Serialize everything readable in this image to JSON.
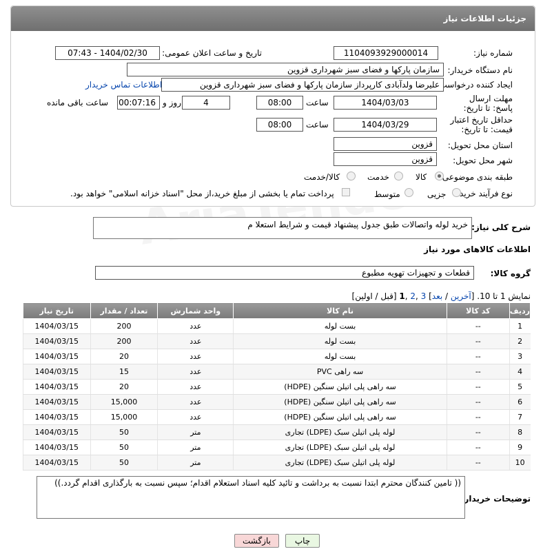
{
  "header": {
    "title": "جزئیات اطلاعات نیاز"
  },
  "watermark": "AriaTender.net",
  "form": {
    "need_number_label": "شماره نیاز:",
    "need_number": "1104093929000014",
    "announce_label": "تاریخ و ساعت اعلان عمومی:",
    "announce_value": "1404/02/30 - 07:43",
    "buyer_org_label": "نام دستگاه خریدار:",
    "buyer_org": "سازمان پارکها و فضای سبز شهرداری قزوین",
    "creator_label": "ایجاد کننده درخواست:",
    "creator": "علیرضا ولدآبادی کارپرداز سازمان پارکها و فضای سبز شهرداری قزوین",
    "contact_link": "اطلاعات تماس خریدار",
    "deadline_label": "مهلت ارسال پاسخ: تا تاریخ:",
    "deadline_date": "1404/03/03",
    "time_label": "ساعت",
    "deadline_time": "08:00",
    "days_value": "4",
    "days_label": "روز و",
    "remaining_value": "00:07:16",
    "remaining_label": "ساعت باقی مانده",
    "validity_label": "حداقل تاریخ اعتبار قیمت: تا تاریخ:",
    "validity_date": "1404/03/29",
    "validity_time": "08:00",
    "province_label": "استان محل تحویل:",
    "province": "قزوین",
    "city_label": "شهر محل تحویل:",
    "city": "قزوین",
    "category_label": "طبقه بندی موضوعی:",
    "category_options": [
      "کالا",
      "خدمت",
      "کالا/خدمت"
    ],
    "process_label": "نوع فرآیند خرید :",
    "process_options": [
      "جزیی",
      "متوسط"
    ],
    "payment_note": "پرداخت تمام یا بخشی از مبلغ خرید،از محل \"اسناد خزانه اسلامی\" خواهد بود."
  },
  "summary": {
    "label": "شرح کلی نیاز:",
    "value": "خرید لوله واتصالات طبق جدول پیشنهاد قیمت و شرایط استعلا م"
  },
  "goods": {
    "section_title": "اطلاعات کالاهای مورد نیاز",
    "group_label": "گروه کالا:",
    "group_value": "قطعات و تجهیزات تهویه مطبوع",
    "pagination": {
      "prefix": "نمایش 1 تا 10. [",
      "last": "آخرین",
      "sep1": " / ",
      "next": "بعد",
      "sep2": "] ",
      "page3": "3",
      "comma1": " ,",
      "page2": "2",
      "comma2": " ,",
      "page1": "1",
      "suffix": " [قبل / اولین]"
    },
    "columns": [
      "ردیف",
      "کد کالا",
      "نام کالا",
      "واحد شمارش",
      "تعداد / مقدار",
      "تاریخ نیاز"
    ],
    "rows": [
      [
        "1",
        "--",
        "بست لوله",
        "عدد",
        "200",
        "1404/03/15"
      ],
      [
        "2",
        "--",
        "بست لوله",
        "عدد",
        "200",
        "1404/03/15"
      ],
      [
        "3",
        "--",
        "بست لوله",
        "عدد",
        "20",
        "1404/03/15"
      ],
      [
        "4",
        "--",
        "سه راهی PVC",
        "عدد",
        "15",
        "1404/03/15"
      ],
      [
        "5",
        "--",
        "سه راهی پلی اتیلن سنگین (HDPE)",
        "عدد",
        "20",
        "1404/03/15"
      ],
      [
        "6",
        "--",
        "سه راهی پلی اتیلن سنگین (HDPE)",
        "عدد",
        "15,000",
        "1404/03/15"
      ],
      [
        "7",
        "--",
        "سه راهی پلی اتیلن سنگین (HDPE)",
        "عدد",
        "15,000",
        "1404/03/15"
      ],
      [
        "8",
        "--",
        "لوله پلی اتیلن سبک (LDPE) تجاری",
        "متر",
        "50",
        "1404/03/15"
      ],
      [
        "9",
        "--",
        "لوله پلی اتیلن سبک (LDPE) تجاری",
        "متر",
        "50",
        "1404/03/15"
      ],
      [
        "10",
        "--",
        "لوله پلی اتیلن سبک (LDPE) تجاری",
        "متر",
        "50",
        "1404/03/15"
      ]
    ]
  },
  "notes": {
    "label": "توضیحات خریدار:",
    "value": "(( تامین کنندگان محترم ابتدا نسبت به برداشت و تائید کلیه اسناد استعلام اقدام؛ سپس نسبت به بارگذاری اقدام گردد.))"
  },
  "buttons": {
    "print": "چاپ",
    "back": "بازگشت"
  },
  "colors": {
    "header": "#7f7f7f",
    "link": "#0645ad",
    "back_button": "#f8d7d7",
    "print_button": "#e9f7e2"
  }
}
